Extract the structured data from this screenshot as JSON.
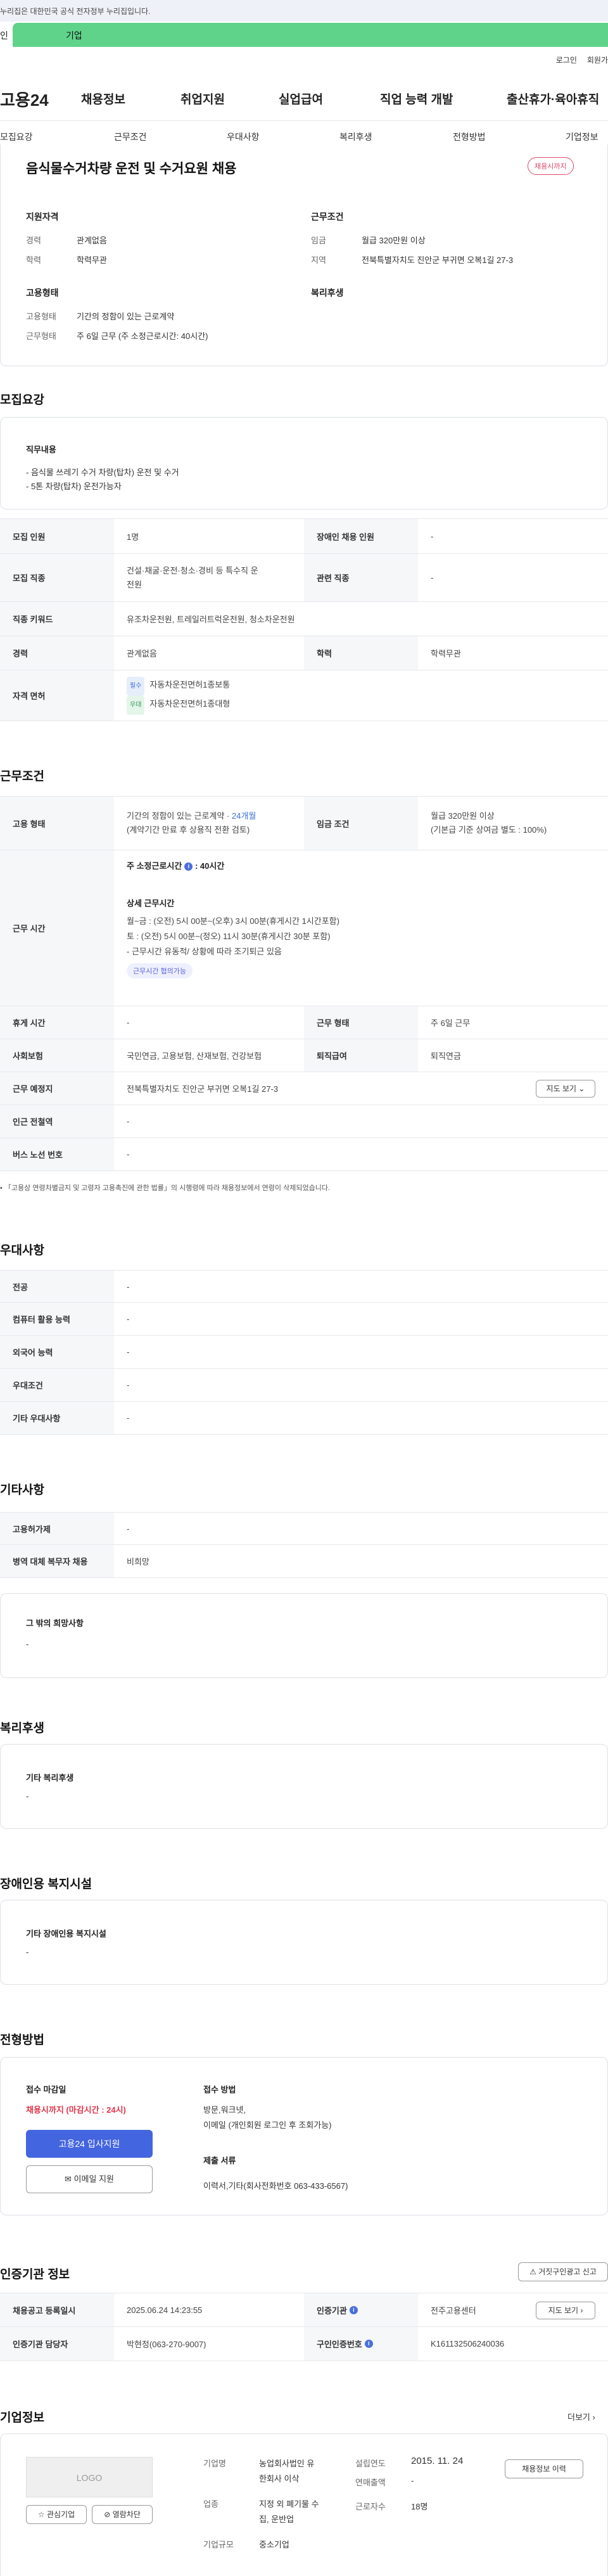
{
  "gov_bar": {
    "text": "누리집은 대한민국 공식 전자정부 누리집입니다."
  },
  "member_tabs": {
    "personal": "인",
    "company": "기업"
  },
  "util": {
    "login": "로그인",
    "join": "회원가"
  },
  "gnb": {
    "logo": "고용24",
    "items": [
      "채용정보",
      "취업지원",
      "실업급여",
      "직업 능력 개발",
      "출산휴가·육아휴직"
    ]
  },
  "subtabs": [
    "모집요강",
    "근무조건",
    "우대사항",
    "복리후생",
    "전형방법",
    "기업정보"
  ],
  "job": {
    "title": "음식물수거차량 운전 및 수거요원 채용",
    "status_badge": "채용시까지"
  },
  "summary": {
    "qualification_title": "지원자격",
    "career_label": "경력",
    "career_value": "관계없음",
    "edu_label": "학력",
    "edu_value": "학력무관",
    "condition_title": "근무조건",
    "wage_label": "임금",
    "wage_value": "월급 320만원 이상",
    "region_label": "지역",
    "region_value": "전북특별자치도 진안군 부귀면 오복1길 27-3",
    "employment_title": "고용형태",
    "emp_type_label": "고용형태",
    "emp_type_value": "기간의 정함이 있는 근로계약",
    "work_form_label": "근무형태",
    "work_form_value": "주 6일 근무 (주 소정근로시간: 40시간)",
    "welfare_title": "복리후생"
  },
  "recruit": {
    "section_title": "모집요강",
    "duty_title": "직무내용",
    "duty_lines": [
      "- 음식물 쓰레기 수거 차량(탑차) 운전 및 수거",
      "- 5톤 차량(탑차) 운전가능자"
    ],
    "headcount_label": "모집 인원",
    "headcount_value": "1명",
    "disabled_label": "장애인 채용 인원",
    "disabled_value": "-",
    "job_label": "모집 직종",
    "job_value_1": "건설·채굴·운전·청소·경비 등 특수직 운",
    "job_value_2": "전원",
    "related_label": "관련 직종",
    "related_value": "-",
    "keyword_label": "직종 키워드",
    "keyword_value": "유조차운전원, 트레일러트럭운전원, 청소차운전원",
    "career_label": "경력",
    "career_value": "관계없음",
    "edu_label": "학력",
    "edu_value": "학력무관",
    "license_label": "자격 면허",
    "license_items": [
      {
        "tag": "필수",
        "text": "자동차운전면허1종보통"
      },
      {
        "tag": "우대",
        "text": "자동차운전면허1종대형"
      }
    ]
  },
  "work": {
    "section_title": "근무조건",
    "emp_label": "고용 형태",
    "emp_value_prefix": "기간의 정함이 있는 근로계약 · ",
    "emp_value_months": "24개월",
    "emp_value_note": "(계약기간 만료 후 상용직 전환 검토)",
    "wage_label": "임금 조건",
    "wage_value_1": "월급 320만원 이상",
    "wage_value_2": "(기본급 기준 상여금 별도 : 100%)",
    "hours_label": "근무 시간",
    "hours_main_prefix": "주 소정근로시간",
    "hours_main_value": ": 40시간",
    "hours_detail_title": "상세 근무시간",
    "hours_lines": [
      "월~금 : (오전) 5시 00분~(오후) 3시 00분(휴게시간 1시간포함)",
      "토 : (오전) 5시 00분~(정오) 11시 30분(휴게시간 30분 포함)",
      "- 근무시간 유동적/ 상황에 따라 조기퇴근 있음"
    ],
    "hours_tag": "근무시간 협의가능",
    "rest_label": "휴게 시간",
    "rest_value": "-",
    "work_form_label": "근무 형태",
    "work_form_value": "주 6일 근무",
    "insurance_label": "사회보험",
    "insurance_value": "국민연금, 고용보험, 산재보험, 건강보험",
    "retire_label": "퇴직급여",
    "retire_value": "퇴직연금",
    "place_label": "근무 예정지",
    "place_value": "전북특별자치도 진안군 부귀면 오복1길 27-3",
    "map_button": "지도 보기",
    "subway_label": "인근 전철역",
    "subway_value": "-",
    "bus_label": "버스 노선 번호",
    "bus_value": "-",
    "footnote": "「고용상 연령차별금지 및 고령자 고용촉진에 관한 법률」의 시행령에 따라 채용정보에서 연령이 삭제되었습니다."
  },
  "preference": {
    "section_title": "우대사항",
    "rows": [
      {
        "label": "전공",
        "value": "-"
      },
      {
        "label": "컴퓨터 활용 능력",
        "value": "-"
      },
      {
        "label": "외국어 능력",
        "value": "-"
      },
      {
        "label": "우대조건",
        "value": "-"
      },
      {
        "label": "기타 우대사항",
        "value": "-"
      }
    ]
  },
  "etc": {
    "section_title": "기타사항",
    "hire_label": "고용허가제",
    "hire_value": "-",
    "military_label": "병역 대체 복무자 채용",
    "military_value": "비희망",
    "other_title": "그 밖의 희망사항",
    "other_value": "-"
  },
  "welfare": {
    "section_title": "복리후생",
    "box_title": "기타 복리후생",
    "box_value": "-"
  },
  "disabled_facility": {
    "section_title": "장애인용 복지시설",
    "box_title": "기타 장애인용 복지시설",
    "box_value": "-"
  },
  "selection": {
    "section_title": "전형방법",
    "deadline_title": "접수 마감일",
    "deadline_value": "채용시까지 (마감시간 : 24시)",
    "apply_button": "고용24 입사지원",
    "email_button": "이메일 지원",
    "method_title": "접수 방법",
    "method_lines": [
      "방문,워크넷,",
      "이메일 (개인회원 로그인 후 조회가능)"
    ],
    "docs_title": "제출 서류",
    "docs_value": "이력서,기타(회사전화번호 063-433-6567)"
  },
  "agency": {
    "section_title": "인증기관 정보",
    "report_button": "거짓구인광고 신고",
    "reg_date_label": "채용공고 등록일시",
    "reg_date_value": "2025.06.24 14:23:55",
    "agency_label": "인증기관",
    "agency_value": "전주고용센터",
    "map_button": "지도 보기",
    "manager_label": "인증기관 담당자",
    "manager_value": "박현정(063-270-9007)",
    "cert_no_label": "구인인증번호",
    "cert_no_value": "K161132506240036"
  },
  "company": {
    "section_title": "기업정보",
    "more_link": "더보기",
    "logo_text": "LOGO",
    "fav_button": "관심기업",
    "block_button": "열람차단",
    "name_label": "기업명",
    "name_value_1": "농업회사법인 유",
    "name_value_2": "한회사 이삭",
    "founded_label": "설립연도",
    "founded_value": "2015. 11. 24",
    "sales_label": "연매출액",
    "sales_value": "-",
    "industry_label": "업종",
    "industry_value_1": "지정 외 폐기물 수",
    "industry_value_2": "집, 운반업",
    "employees_label": "근로자수",
    "employees_value": "18명",
    "size_label": "기업규모",
    "size_value": "중소기업",
    "history_button": "채용정보 이력"
  }
}
